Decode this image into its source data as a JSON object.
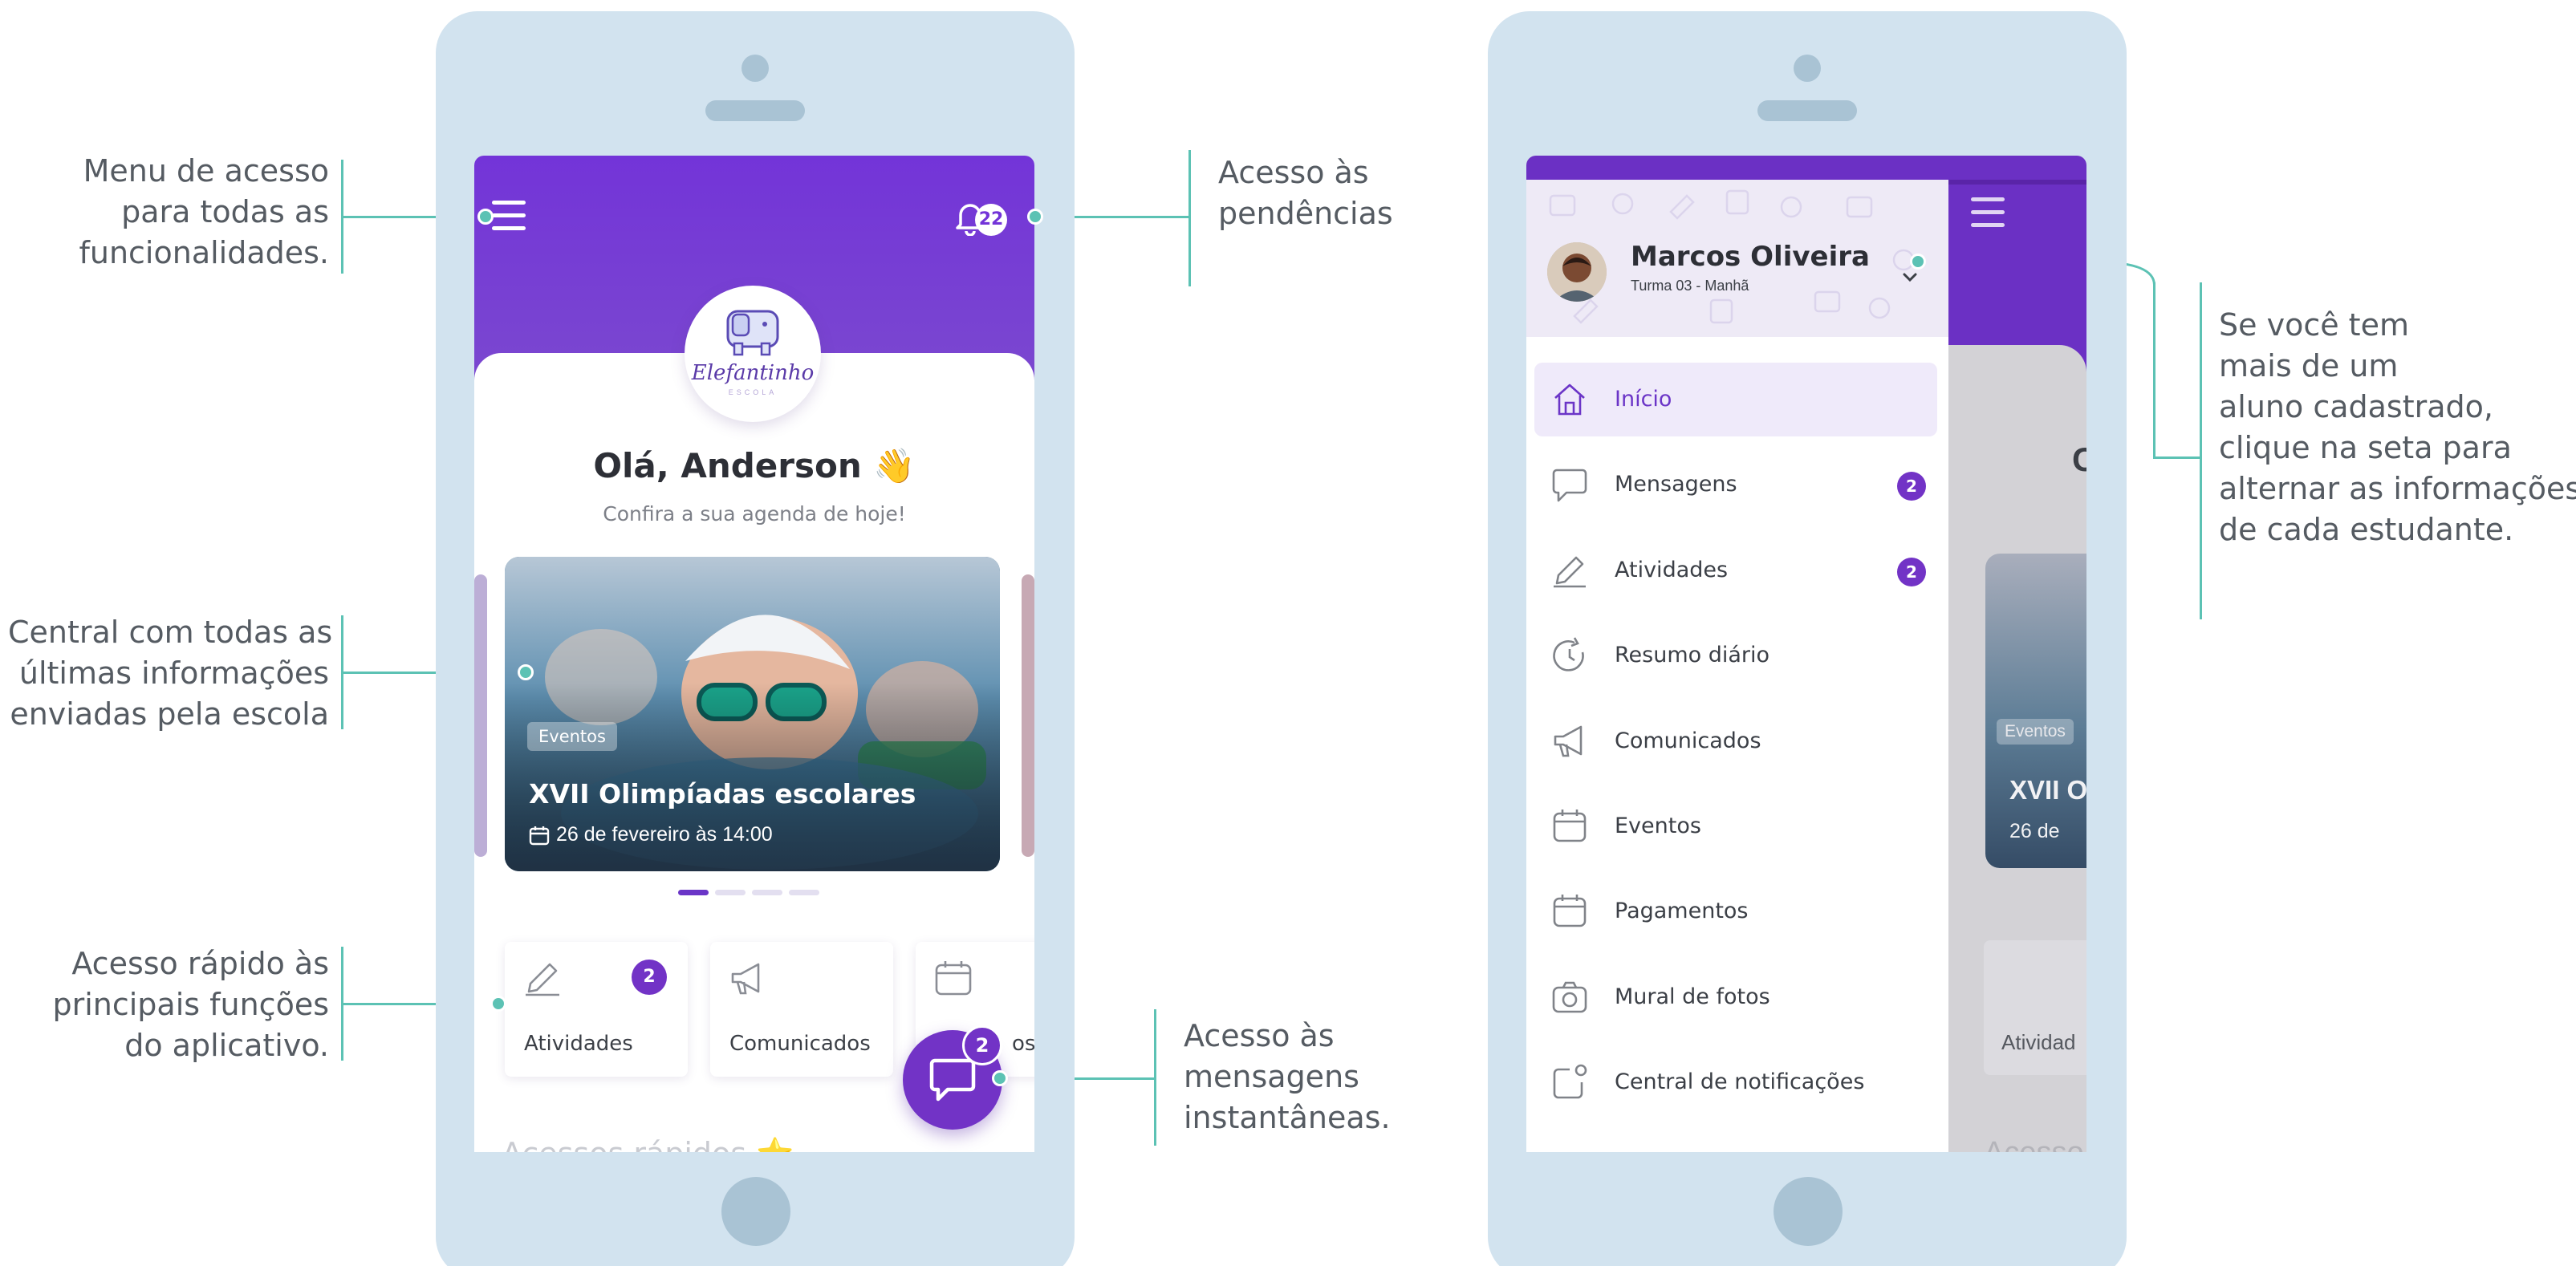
{
  "annotations": {
    "menu": [
      "Menu de acesso",
      "para todas as",
      "funcionalidades."
    ],
    "pendencias": [
      "Acesso às",
      "pendências"
    ],
    "central": [
      "Central com todas as",
      "últimas informações",
      "enviadas pela escola"
    ],
    "acesso_rapido": [
      "Acesso rápido às",
      "principais funções",
      "do aplicativo."
    ],
    "mensagens": [
      "Acesso às",
      "mensagens",
      "instantâneas."
    ],
    "aluno": [
      "Se você tem",
      "mais de um",
      "aluno cadastrado,",
      "clique na seta para",
      "alternar as informações",
      "de cada estudante."
    ]
  },
  "home": {
    "notification_count": "22",
    "logo_text": "Elefantinho",
    "logo_subtext": "ESCOLA",
    "greeting": "Olá, Anderson",
    "greeting_emoji": "👋",
    "subtitle": "Confira a sua agenda de hoje!",
    "slide": {
      "tag": "Eventos",
      "title": "XVII Olimpíadas escolares",
      "date": "26 de fevereiro às 14:00"
    },
    "carousel_active_index": 0,
    "quick_actions": [
      {
        "label": "Atividades",
        "icon": "pencil-icon",
        "badge": "2"
      },
      {
        "label": "Comunicados",
        "icon": "megaphone-icon",
        "badge": ""
      },
      {
        "label": "os",
        "icon": "calendar-icon",
        "badge": ""
      }
    ],
    "chat_badge": "2",
    "section_title": "Acessos rápidos",
    "section_emoji": "⭐"
  },
  "drawer": {
    "student_name": "Marcos Oliveira",
    "student_class": "Turma 03 - Manhã",
    "items": [
      {
        "label": "Início",
        "icon": "home-icon",
        "badge": "",
        "active": true
      },
      {
        "label": "Mensagens",
        "icon": "chat-icon",
        "badge": "2",
        "active": false
      },
      {
        "label": "Atividades",
        "icon": "pencil-icon",
        "badge": "2",
        "active": false
      },
      {
        "label": "Resumo diário",
        "icon": "clock-icon",
        "badge": "",
        "active": false
      },
      {
        "label": "Comunicados",
        "icon": "megaphone-icon",
        "badge": "",
        "active": false
      },
      {
        "label": "Eventos",
        "icon": "calendar-icon",
        "badge": "",
        "active": false
      },
      {
        "label": "Pagamentos",
        "icon": "calendar-icon",
        "badge": "",
        "active": false
      },
      {
        "label": "Mural de fotos",
        "icon": "camera-icon",
        "badge": "",
        "active": false
      },
      {
        "label": "Central de notificações",
        "icon": "notification-icon",
        "badge": "",
        "active": false
      }
    ],
    "behind_greeting_letter": "C",
    "behind_slide_tag": "Eventos",
    "behind_slide_title": "XVII O",
    "behind_slide_date": "26 de",
    "behind_quick_label": "Atividad",
    "behind_section": "Acesso"
  },
  "colors": {
    "purple": "#7334d8",
    "teal": "#5cc2b4",
    "phone_frame": "#d2e3ef"
  }
}
